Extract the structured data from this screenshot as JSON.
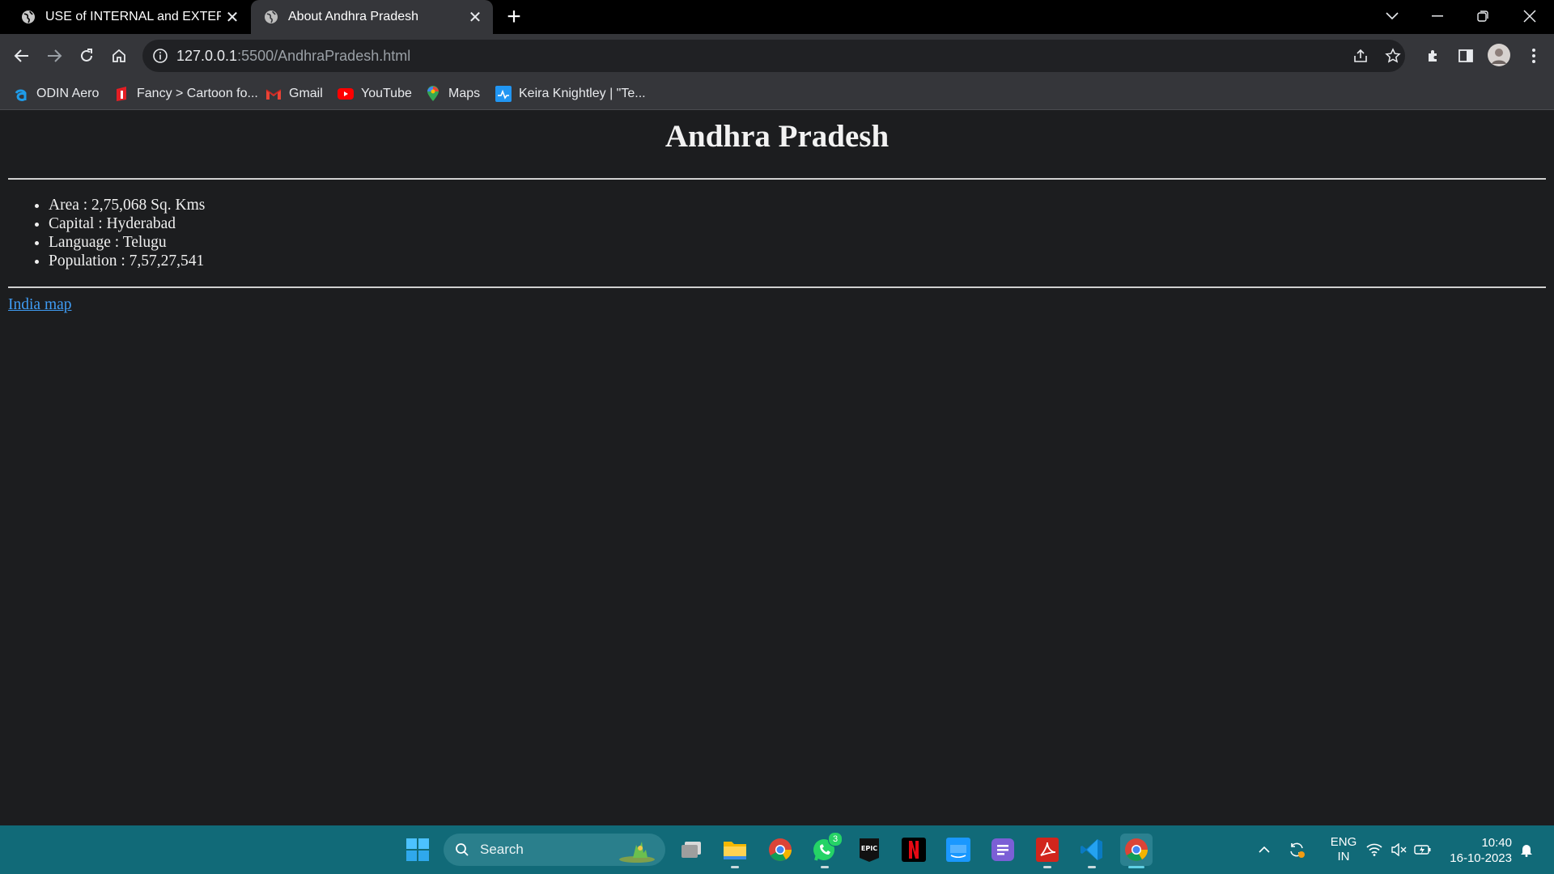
{
  "browser": {
    "tabs": [
      {
        "title": "USE of INTERNAL and EXTERNAL",
        "active": false
      },
      {
        "title": "About Andhra Pradesh",
        "active": true
      }
    ],
    "new_tab_label": "+",
    "url_host": "127.0.0.1",
    "url_rest": ":5500/AndhraPradesh.html",
    "bookmarks": [
      {
        "label": "ODIN Aero",
        "icon": "odin-icon"
      },
      {
        "label": "Fancy > Cartoon fo...",
        "icon": "fancy-icon"
      },
      {
        "label": "Gmail",
        "icon": "gmail-icon"
      },
      {
        "label": "YouTube",
        "icon": "youtube-icon"
      },
      {
        "label": "Maps",
        "icon": "maps-icon"
      },
      {
        "label": "Keira Knightley | \"Te...",
        "icon": "bookmark-site-icon"
      }
    ]
  },
  "page": {
    "heading": "Andhra Pradesh",
    "facts": [
      "Area : 2,75,068 Sq. Kms",
      "Capital : Hyderabad",
      "Language : Telugu",
      "Population : 7,57,27,541"
    ],
    "link_text": "India map"
  },
  "taskbar": {
    "search_placeholder": "Search",
    "whatsapp_badge": "3",
    "language_line1": "ENG",
    "language_line2": "IN",
    "time": "10:40",
    "date": "16-10-2023"
  },
  "colors": {
    "page_background": "#1c1d1f",
    "link": "#3f9cf4",
    "taskbar": "#116a78",
    "toolbar": "#35363a"
  }
}
